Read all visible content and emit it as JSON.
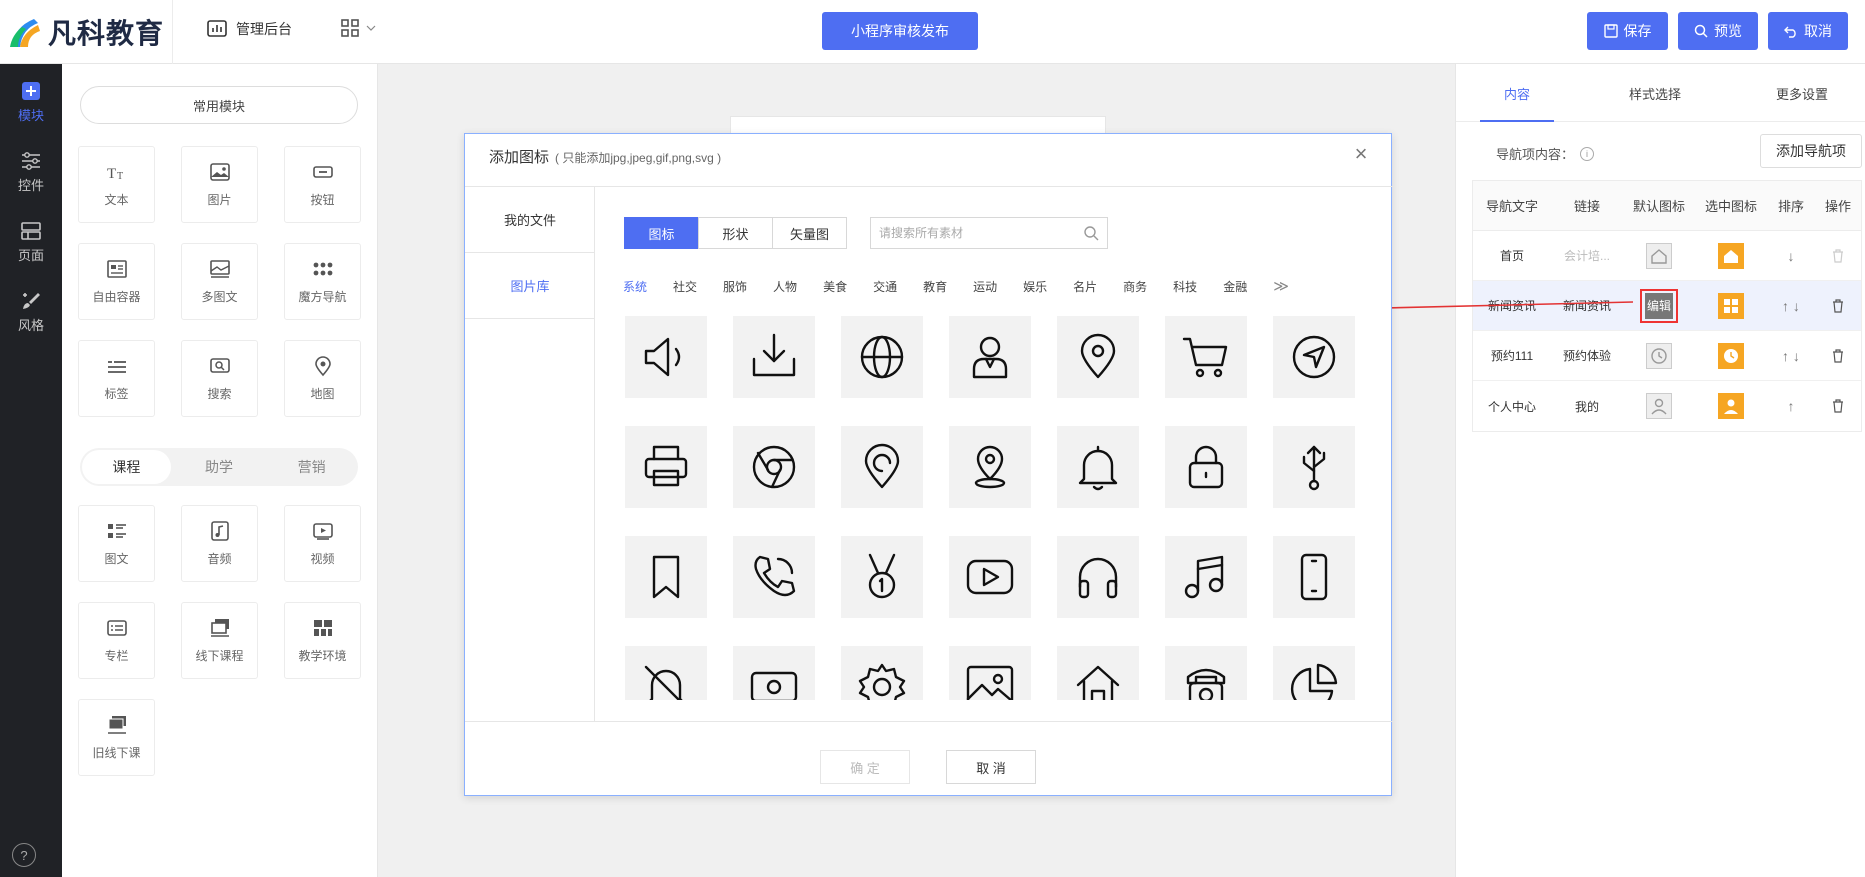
{
  "header": {
    "brand": "凡科教育",
    "admin_label": "管理后台",
    "publish_label": "小程序审核发布",
    "save_label": "保存",
    "preview_label": "预览",
    "cancel_label": "取消"
  },
  "rail": {
    "items": [
      {
        "label": "模块",
        "icon": "plus-square-icon"
      },
      {
        "label": "控件",
        "icon": "sliders-icon"
      },
      {
        "label": "页面",
        "icon": "layout-icon"
      },
      {
        "label": "风格",
        "icon": "brush-icon"
      }
    ],
    "help": "?"
  },
  "modules": {
    "common_label": "常用模块",
    "common": [
      "文本",
      "图片",
      "按钮",
      "自由容器",
      "多图文",
      "魔方导航",
      "标签",
      "搜索",
      "地图"
    ],
    "segments": [
      "课程",
      "助学",
      "营销"
    ],
    "course": [
      "图文",
      "音频",
      "视频",
      "专栏",
      "线下课程",
      "教学环境",
      "旧线下课"
    ]
  },
  "right_panel": {
    "tabs": [
      "内容",
      "样式选择",
      "更多设置"
    ],
    "nav_label": "导航项内容：",
    "add_nav_label": "添加导航项",
    "table_headers": [
      "导航文字",
      "链接",
      "默认图标",
      "选中图标",
      "排序",
      "操作"
    ],
    "rows": [
      {
        "text": "首页",
        "link": "会计培...",
        "sort": "↓"
      },
      {
        "text": "新闻资讯",
        "link": "新闻资讯",
        "sort": "↑ ↓",
        "edit_label": "编辑"
      },
      {
        "text": "预约111",
        "link": "预约体验",
        "sort": "↑ ↓"
      },
      {
        "text": "个人中心",
        "link": "我的",
        "sort": "↑"
      }
    ]
  },
  "modal": {
    "title": "添加图标",
    "subtitle": "( 只能添加jpg,jpeg,gif,png,svg )",
    "close": "×",
    "sidebar": [
      "我的文件",
      "图片库"
    ],
    "tabs": [
      "图标",
      "形状",
      "矢量图"
    ],
    "search_placeholder": "请搜索所有素材",
    "categories": [
      "系统",
      "社交",
      "服饰",
      "人物",
      "美食",
      "交通",
      "教育",
      "运动",
      "娱乐",
      "名片",
      "商务",
      "科技",
      "金融"
    ],
    "more": "≫",
    "icons": [
      "speaker-icon",
      "download-tray-icon",
      "globe-icon",
      "user-icon",
      "map-pin-icon",
      "shopping-cart-icon",
      "navigation-icon",
      "printer-icon",
      "chrome-icon",
      "location-icon",
      "place-marker-icon",
      "bell-icon",
      "lock-icon",
      "usb-icon",
      "bookmark-icon",
      "phone-call-icon",
      "medal-icon",
      "video-play-icon",
      "headphones-icon",
      "music-note-icon",
      "smartphone-icon",
      "bell-off-icon",
      "banknote-icon",
      "settings-gear-icon",
      "image-icon",
      "home-icon",
      "telephone-icon",
      "pie-chart-icon"
    ],
    "ok_label": "确 定",
    "cancel_label": "取 消"
  },
  "colors": {
    "accent": "#4e6ef2",
    "rail_bg": "#202226",
    "orange": "#f6a623",
    "annotation": "#e33333"
  }
}
